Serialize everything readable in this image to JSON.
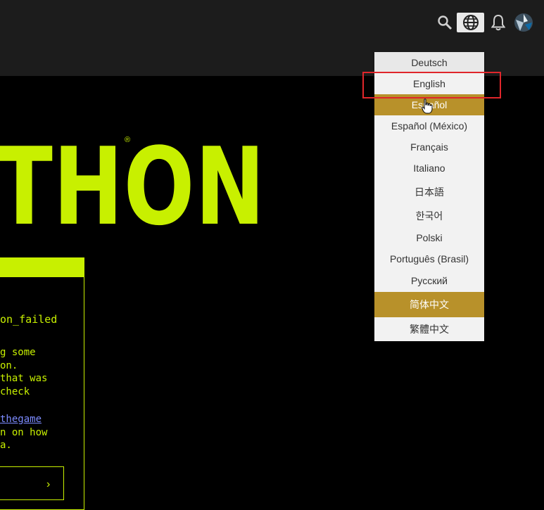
{
  "header": {
    "icons": [
      "search-icon",
      "globe-icon",
      "bell-icon",
      "avatar"
    ]
  },
  "logo": {
    "text": "THON",
    "reg": "®"
  },
  "message": {
    "error_code": "on_failed",
    "lines": [
      "g some",
      "on.",
      " that was",
      " check"
    ],
    "link": "thegame",
    "lines_after": [
      "n on how",
      "a."
    ]
  },
  "action": {
    "chevron": "›"
  },
  "language_menu": {
    "items": [
      "Deutsch",
      "English",
      "Español",
      "Español (México)",
      "Français",
      "Italiano",
      "日本語",
      "한국어",
      "Polski",
      "Português (Brasil)",
      "Русский",
      "简体中文",
      "繁體中文"
    ],
    "highlighted": [
      "Español",
      "简体中文"
    ],
    "marked": "English",
    "colors": {
      "highlight": "#b8912a",
      "marker": "#e0262b",
      "accent": "#c8f000"
    }
  }
}
